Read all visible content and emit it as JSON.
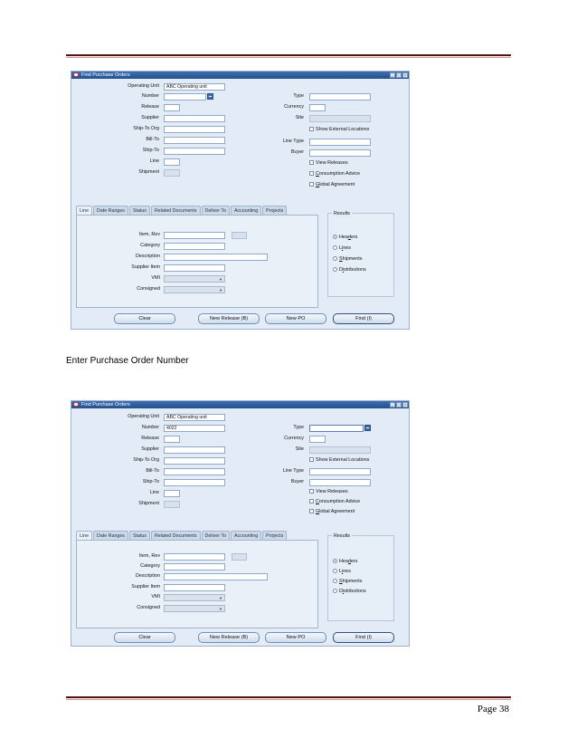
{
  "window": {
    "title": "Find Purchase Orders",
    "controls": [
      "minimize-icon",
      "maximize-icon",
      "close-icon"
    ]
  },
  "labels": {
    "operating_unit": "Operating Unit",
    "number": "Number",
    "release": "Release",
    "supplier": "Supplier",
    "ship_to_org": "Ship-To Org",
    "bill_to": "Bill-To",
    "ship_to": "Ship-To",
    "line": "Line",
    "shipment": "Shipment",
    "type": "Type",
    "currency": "Currency",
    "site": "Site",
    "line_type": "Line Type",
    "buyer": "Buyer"
  },
  "checkboxes": {
    "show_external_pre": "Show",
    "show_external_u": "",
    "show_external_post": " External Locations",
    "view_releases": "View Releases",
    "consumption_pre": "",
    "consumption_u": "C",
    "consumption_post": "onsumption Advice",
    "global_pre": "",
    "global_u": "G",
    "global_post": "lobal Agreement"
  },
  "tabs": [
    "Line",
    "Date Ranges",
    "Status",
    "Related Documents",
    "Deliver To",
    "Accounting",
    "Projects"
  ],
  "line_tab": {
    "item_rev": "Item, Rev",
    "category": "Category",
    "description": "Description",
    "supplier_item": "Supplier Item",
    "vmi": "VMI",
    "consigned": "Consigned"
  },
  "results": {
    "title": "Results",
    "options": [
      {
        "pre": "Hea",
        "u": "d",
        "post": "ers",
        "selected": true
      },
      {
        "pre": "L",
        "u": "i",
        "post": "nes",
        "selected": false
      },
      {
        "pre": "",
        "u": "S",
        "post": "hipments",
        "selected": false
      },
      {
        "pre": "D",
        "u": "i",
        "post": "stributions",
        "selected": false
      }
    ]
  },
  "buttons": {
    "clear": "Clear",
    "new_release": "New Release (B)",
    "new_po": "New PO",
    "find": "Find (I)"
  },
  "screen1": {
    "operating_unit_value": "ABC Operating unit",
    "number_value": ""
  },
  "screen2": {
    "operating_unit_value": "ABC Operating unit",
    "number_value": "4022"
  },
  "caption": "Enter Purchase Order Number",
  "footer": {
    "page": "Page 38"
  },
  "colors": {
    "rule": "#5a0f0f",
    "titlebar": "#24508e",
    "form_bg": "#e3ecf6"
  }
}
